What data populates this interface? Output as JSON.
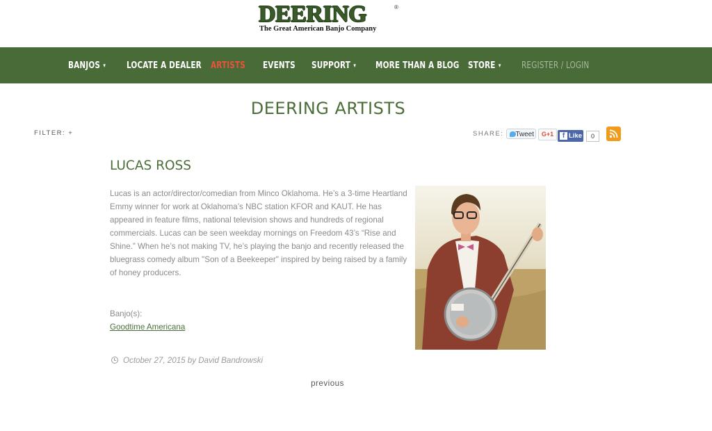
{
  "brand": {
    "name": "DEERING",
    "reg": "®",
    "tagline": "The Great American Banjo Company"
  },
  "nav": {
    "items": [
      {
        "label": "BANJOS",
        "caret": "▾"
      },
      {
        "label": "LOCATE A DEALER"
      },
      {
        "label": "ARTISTS"
      },
      {
        "label": "EVENTS"
      },
      {
        "label": "SUPPORT",
        "caret": "▾"
      },
      {
        "label": "MORE THAN A BLOG"
      },
      {
        "label": "STORE",
        "caret": "▾"
      },
      {
        "label": "REGISTER / LOGIN"
      }
    ],
    "active": "ARTISTS",
    "colors": {
      "bg": "#496b37",
      "active": "#e8533a"
    }
  },
  "page": {
    "title": "DEERING ARTISTS",
    "filter_label": "FILTER: +"
  },
  "share": {
    "label": "SHARE:",
    "tweet": "Tweet",
    "gplus": "G+1",
    "like": "Like",
    "like_count": "0",
    "rss_icon": "rss-icon"
  },
  "artist": {
    "name": "LUCAS ROSS",
    "bio": "Lucas is an actor/director/comedian from Minco Oklahoma. He’s a 3-time Heartland Emmy winner for work at Oklahoma’s NBC station KFOR and KAUT. He has appeared in feature films, national television shows and hundreds of regional commercials. Lucas can be seen weekday mornings on Freedom 43’s “Rise and Shine.” When he’s not making TV, he’s playing the banjo and recently released the bluegrass comedy album \"Son of a Beekeeper\" inspired by being raised by a family of honey producers.",
    "banjo_label": "Banjo(s):",
    "banjo_link": "Goodtime Americana",
    "meta": "October 27, 2015 by David Bandrowski"
  },
  "pagination": {
    "previous": "previous"
  }
}
